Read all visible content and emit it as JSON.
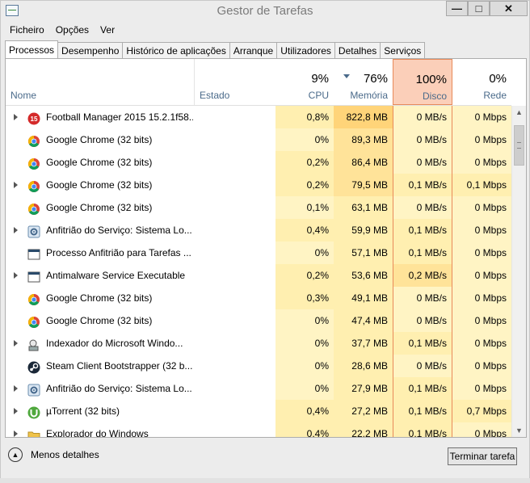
{
  "window": {
    "title": "Gestor de Tarefas",
    "min_glyph": "—",
    "max_glyph": "□",
    "close_glyph": "✕"
  },
  "menu": [
    "Ficheiro",
    "Opções",
    "Ver"
  ],
  "tabs": [
    "Processos",
    "Desempenho",
    "Histórico de aplicações",
    "Arranque",
    "Utilizadores",
    "Detalhes",
    "Serviços"
  ],
  "active_tab": "Processos",
  "header": {
    "name": "Nome",
    "status": "Estado",
    "cpu_pct": "9%",
    "cpu": "CPU",
    "mem_pct": "76%",
    "mem": "Memória",
    "disk_pct": "100%",
    "disk": "Disco",
    "net_pct": "0%",
    "net": "Rede"
  },
  "processes": [
    {
      "name": "Football Manager 2015 15.2.1f58...",
      "icon": "fm-icon",
      "expandable": true,
      "cpu": "0,8%",
      "mem": "822,8 MB",
      "disk": "0 MB/s",
      "net": "0 Mbps"
    },
    {
      "name": "Google Chrome (32 bits)",
      "icon": "chrome-icon",
      "expandable": false,
      "cpu": "0%",
      "mem": "89,3 MB",
      "disk": "0 MB/s",
      "net": "0 Mbps"
    },
    {
      "name": "Google Chrome (32 bits)",
      "icon": "chrome-icon",
      "expandable": false,
      "cpu": "0,2%",
      "mem": "86,4 MB",
      "disk": "0 MB/s",
      "net": "0 Mbps"
    },
    {
      "name": "Google Chrome (32 bits)",
      "icon": "chrome-icon",
      "expandable": true,
      "cpu": "0,2%",
      "mem": "79,5 MB",
      "disk": "0,1 MB/s",
      "net": "0,1 Mbps"
    },
    {
      "name": "Google Chrome (32 bits)",
      "icon": "chrome-icon",
      "expandable": false,
      "cpu": "0,1%",
      "mem": "63,1 MB",
      "disk": "0 MB/s",
      "net": "0 Mbps"
    },
    {
      "name": "Anfitrião do Serviço: Sistema Lo...",
      "icon": "service-host-icon",
      "expandable": true,
      "cpu": "0,4%",
      "mem": "59,9 MB",
      "disk": "0,1 MB/s",
      "net": "0 Mbps"
    },
    {
      "name": "Processo Anfitrião para Tarefas ...",
      "icon": "window-icon",
      "expandable": false,
      "cpu": "0%",
      "mem": "57,1 MB",
      "disk": "0,1 MB/s",
      "net": "0 Mbps"
    },
    {
      "name": "Antimalware Service Executable",
      "icon": "window-icon",
      "expandable": true,
      "cpu": "0,2%",
      "mem": "53,6 MB",
      "disk": "0,2 MB/s",
      "net": "0 Mbps"
    },
    {
      "name": "Google Chrome (32 bits)",
      "icon": "chrome-icon",
      "expandable": false,
      "cpu": "0,3%",
      "mem": "49,1 MB",
      "disk": "0 MB/s",
      "net": "0 Mbps"
    },
    {
      "name": "Google Chrome (32 bits)",
      "icon": "chrome-icon",
      "expandable": false,
      "cpu": "0%",
      "mem": "47,4 MB",
      "disk": "0 MB/s",
      "net": "0 Mbps"
    },
    {
      "name": "Indexador do Microsoft Windo...",
      "icon": "indexer-icon",
      "expandable": true,
      "cpu": "0%",
      "mem": "37,7 MB",
      "disk": "0,1 MB/s",
      "net": "0 Mbps"
    },
    {
      "name": "Steam Client Bootstrapper (32 b...",
      "icon": "steam-icon",
      "expandable": false,
      "cpu": "0%",
      "mem": "28,6 MB",
      "disk": "0 MB/s",
      "net": "0 Mbps"
    },
    {
      "name": "Anfitrião do Serviço: Sistema Lo...",
      "icon": "service-host-icon",
      "expandable": true,
      "cpu": "0%",
      "mem": "27,9 MB",
      "disk": "0,1 MB/s",
      "net": "0 Mbps"
    },
    {
      "name": "µTorrent (32 bits)",
      "icon": "utorrent-icon",
      "expandable": true,
      "cpu": "0,4%",
      "mem": "27,2 MB",
      "disk": "0,1 MB/s",
      "net": "0,7 Mbps"
    },
    {
      "name": "Explorador do Windows",
      "icon": "folder-icon",
      "expandable": true,
      "cpu": "0,4%",
      "mem": "22,2 MB",
      "disk": "0,1 MB/s",
      "net": "0 Mbps"
    }
  ],
  "footer": {
    "fewer_details": "Menos detalhes",
    "end_task": "Terminar tarefa"
  },
  "colors": {
    "heat_light": "#fff4c4",
    "heat_mid": "#ffefb0",
    "heat_strong": "#ffd479",
    "disk_header_hot": "#fbcfb9"
  }
}
